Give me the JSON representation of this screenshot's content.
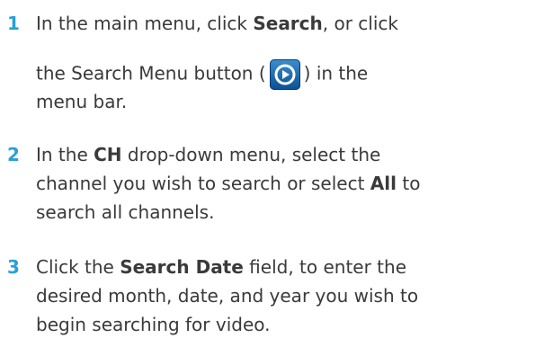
{
  "steps": [
    {
      "number": "1",
      "line1": {
        "pre": "In the main menu, click ",
        "bold": "Search",
        "post": ", or click"
      },
      "line2": {
        "pre": "the Search Menu button (",
        "icon": "search-menu-play-icon",
        "post": ") in the"
      },
      "line3": "menu bar."
    },
    {
      "number": "2",
      "line1": {
        "pre": "In the ",
        "bold": "CH",
        "post": " drop-down menu, select the"
      },
      "line2": {
        "pre": "channel you wish to search or select ",
        "bold": "All",
        "post": " to"
      },
      "line3": "search all channels."
    },
    {
      "number": "3",
      "line1": {
        "pre": "Click the ",
        "bold": "Search Date",
        "post": " field, to enter the"
      },
      "line2": "desired month, date, and year you wish to",
      "line3": "begin searching for video."
    }
  ],
  "colors": {
    "number": "#2a9fd6",
    "text": "#3a3a3a",
    "icon_bg": "#1565b0"
  }
}
